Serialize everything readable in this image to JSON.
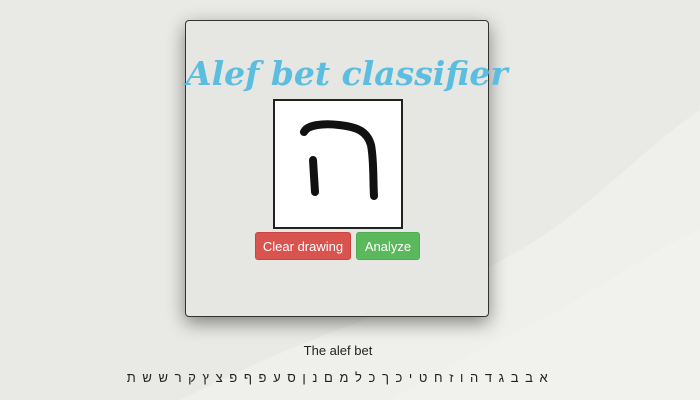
{
  "app": {
    "title": "Alef bet classifier"
  },
  "drawing": {
    "stroke_color": "#111111",
    "background": "#ffffff"
  },
  "buttons": {
    "clear_label": "Clear drawing",
    "analyze_label": "Analyze"
  },
  "alefbet": {
    "heading": "The alef bet",
    "letters": "א ב ב ג ד ה ו ז ח ט י כ ך כ ל מ ם נ ן ס ע פ ף פ צ ץ ק ר ש ש ת"
  },
  "colors": {
    "title": "#5bbde0",
    "clear_button": "#d9534f",
    "analyze_button": "#5cb85c"
  }
}
